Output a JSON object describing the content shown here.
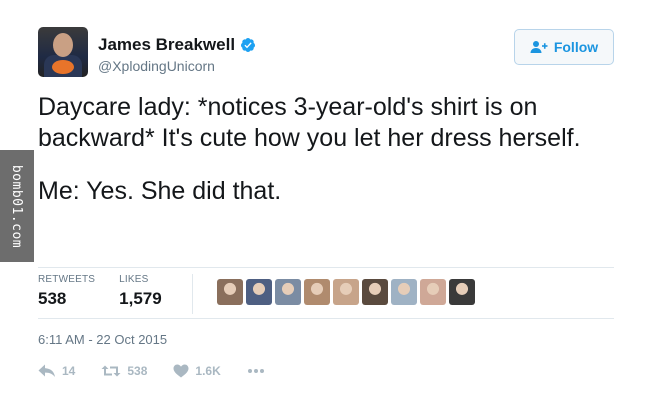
{
  "watermark": "bomb01.com",
  "user": {
    "display_name": "James Breakwell",
    "handle": "@XplodingUnicorn"
  },
  "follow_button": {
    "label": "Follow"
  },
  "tweet": {
    "paragraphs": [
      "Daycare lady: *notices 3-year-old's shirt is on backward* It's cute how you let her dress herself.",
      "Me: Yes. She did that."
    ]
  },
  "stats": {
    "retweets": {
      "label": "RETWEETS",
      "value": "538"
    },
    "likes": {
      "label": "LIKES",
      "value": "1,579"
    }
  },
  "likers": [
    {
      "icon": "liker-avatar",
      "color": "#8a6f5c"
    },
    {
      "icon": "liker-avatar",
      "color": "#4e5f82"
    },
    {
      "icon": "liker-avatar",
      "color": "#7b8ca3"
    },
    {
      "icon": "liker-avatar",
      "color": "#b08b6e"
    },
    {
      "icon": "liker-avatar",
      "color": "#c7a48a"
    },
    {
      "icon": "liker-avatar",
      "color": "#5a4a3e"
    },
    {
      "icon": "liker-avatar",
      "color": "#9fb2c4"
    },
    {
      "icon": "liker-avatar",
      "color": "#cfa897"
    },
    {
      "icon": "liker-avatar",
      "color": "#3a3a3a"
    }
  ],
  "timestamp": "6:11 AM - 22 Oct 2015",
  "actions": {
    "reply": {
      "icon": "reply-icon",
      "count": "14"
    },
    "retweet": {
      "icon": "retweet-icon",
      "count": "538"
    },
    "like": {
      "icon": "heart-icon",
      "count": "1.6K"
    },
    "more": {
      "icon": "more-icon"
    }
  },
  "colors": {
    "accent": "#1b95e0",
    "verified": "#1da1f2",
    "muted": "#657786",
    "action_gray": "#aab8c2"
  }
}
